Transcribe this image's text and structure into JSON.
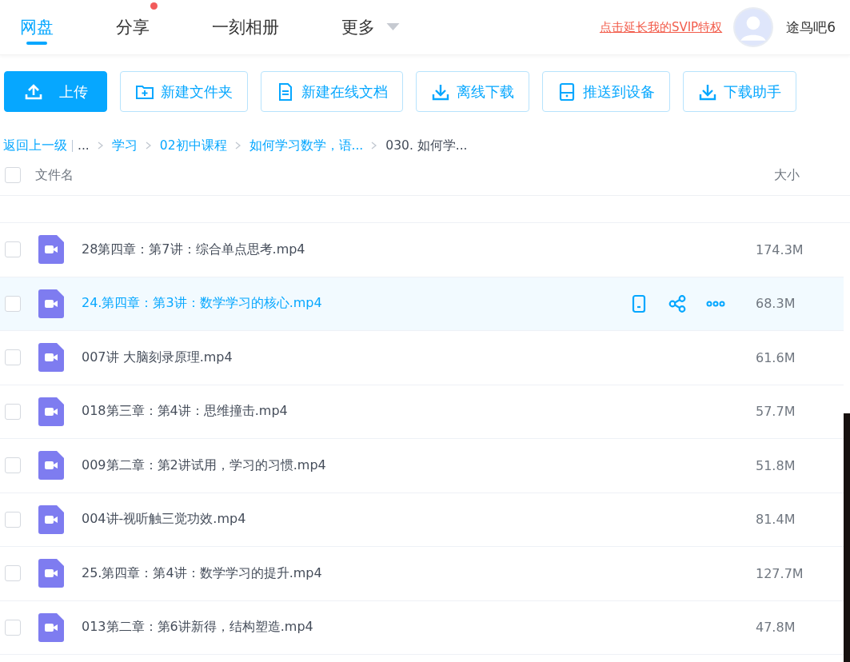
{
  "nav": {
    "tabs": [
      {
        "label": "网盘",
        "selected": true,
        "badge": false,
        "dropdown": false
      },
      {
        "label": "分享",
        "selected": false,
        "badge": true,
        "dropdown": false
      },
      {
        "label": "一刻相册",
        "selected": false,
        "badge": false,
        "dropdown": false
      },
      {
        "label": "更多",
        "selected": false,
        "badge": false,
        "dropdown": true
      }
    ],
    "promo_link": "点击延长我的SVIP特权",
    "user_name": "途鸟吧6"
  },
  "toolbar": [
    {
      "label": "上传",
      "kind": "upload",
      "primary": true
    },
    {
      "label": "新建文件夹",
      "kind": "folder",
      "primary": false
    },
    {
      "label": "新建在线文档",
      "kind": "doc",
      "primary": false
    },
    {
      "label": "离线下载",
      "kind": "download",
      "primary": false
    },
    {
      "label": "推送到设备",
      "kind": "device",
      "primary": false
    },
    {
      "label": "下载助手",
      "kind": "download",
      "primary": false
    }
  ],
  "breadcrumb": {
    "back": "返回上一级",
    "items": [
      {
        "label": "...",
        "kind": "ellipsis"
      },
      {
        "label": "学习",
        "kind": "link"
      },
      {
        "label": "02初中课程",
        "kind": "link"
      },
      {
        "label": "如何学习数学，语...",
        "kind": "link"
      },
      {
        "label": "030. 如何学...",
        "kind": "current"
      }
    ]
  },
  "table": {
    "columns": [
      "文件名",
      "大小"
    ],
    "select_all_checked": false,
    "rows": [
      {
        "name": "28第四章：第7讲：综合单点思考.mp4",
        "size": "174.3M",
        "hovered": false,
        "checked": false
      },
      {
        "name": "24.第四章：第3讲：数学学习的核心.mp4",
        "size": "68.3M",
        "hovered": true,
        "checked": false
      },
      {
        "name": "007讲 大脑刻录原理.mp4",
        "size": "61.6M",
        "hovered": false,
        "checked": false
      },
      {
        "name": "018第三章：第4讲：思维撞击.mp4",
        "size": "57.7M",
        "hovered": false,
        "checked": false
      },
      {
        "name": "009第二章：第2讲试用，学习的习惯.mp4",
        "size": "51.8M",
        "hovered": false,
        "checked": false
      },
      {
        "name": "004讲-视听触三觉功效.mp4",
        "size": "81.4M",
        "hovered": false,
        "checked": false
      },
      {
        "name": "25.第四章：第4讲：数学学习的提升.mp4",
        "size": "127.7M",
        "hovered": false,
        "checked": false
      },
      {
        "name": "013第二章：第6讲新得，结构塑造.mp4",
        "size": "47.8M",
        "hovered": false,
        "checked": false
      }
    ]
  }
}
